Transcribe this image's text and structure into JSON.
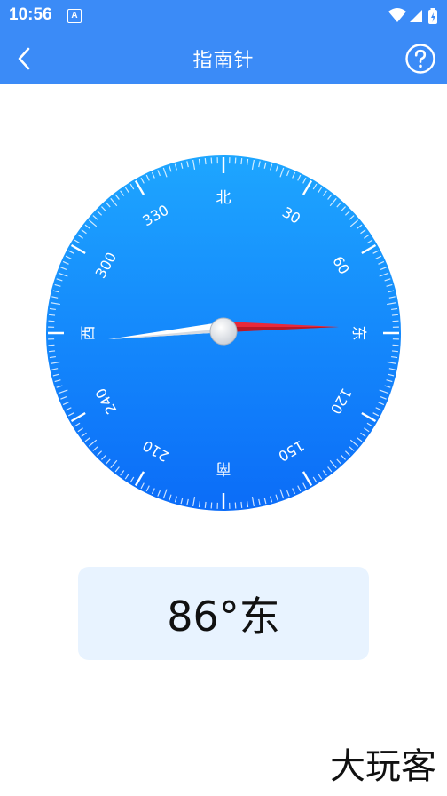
{
  "status_bar": {
    "time": "10:56",
    "a_icon": "A",
    "icons": [
      "wifi-icon",
      "signal-icon",
      "battery-icon"
    ]
  },
  "app_bar": {
    "title": "指南针",
    "back_icon": "chevron-left-icon",
    "help_icon": "help-circle-icon"
  },
  "compass": {
    "cardinals": {
      "north": "北",
      "east": "东",
      "south": "南",
      "west": "西"
    },
    "degree_labels": [
      "30",
      "60",
      "120",
      "150",
      "210",
      "240",
      "300",
      "330"
    ],
    "heading_degrees": 86
  },
  "reading": {
    "text": "86°东"
  },
  "watermark": {
    "text": "大玩客"
  },
  "colors": {
    "primary": "#3b8bf7",
    "dial_top": "#1ea6ff",
    "dial_bottom": "#0b6cf8",
    "needle_red": "#e8293a",
    "card_bg": "#e8f3ff"
  }
}
